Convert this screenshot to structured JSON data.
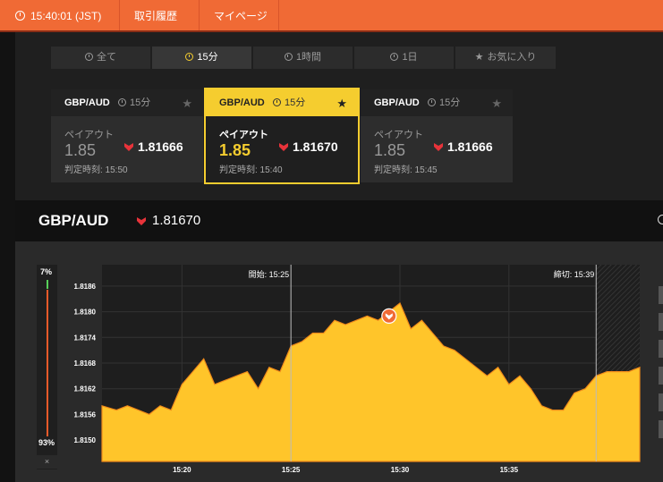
{
  "topbar": {
    "time": "15:40:01 (JST)",
    "history": "取引履歴",
    "mypage": "マイページ"
  },
  "tabs": [
    {
      "label": "全て",
      "icon": "clock-icon",
      "active": false
    },
    {
      "label": "15分",
      "icon": "clock-icon",
      "active": true
    },
    {
      "label": "1時間",
      "icon": "clock-icon",
      "active": false
    },
    {
      "label": "1日",
      "icon": "clock-icon",
      "active": false
    },
    {
      "label": "お気に入り",
      "icon": "star-icon",
      "active": false
    }
  ],
  "cards": [
    {
      "symbol": "GBP/AUD",
      "timeframe": "15分",
      "payout_label": "ペイアウト",
      "payout": "1.85",
      "rate": "1.81666",
      "expiry": "判定時刻: 15:50",
      "selected": false
    },
    {
      "symbol": "GBP/AUD",
      "timeframe": "15分",
      "payout_label": "ペイアウト",
      "payout": "1.85",
      "rate": "1.81670",
      "expiry": "判定時刻: 15:40",
      "selected": true
    },
    {
      "symbol": "GBP/AUD",
      "timeframe": "15分",
      "payout_label": "ペイアウト",
      "payout": "1.85",
      "rate": "1.81666",
      "expiry": "判定時刻: 15:45",
      "selected": false
    }
  ],
  "pair": {
    "symbol": "GBP/AUD",
    "rate": "1.81670"
  },
  "gauge": {
    "top_label": "7%",
    "bottom_label": "93%",
    "close_label": "×",
    "up_fraction": 0.07
  },
  "colors": {
    "accent": "#f06a35",
    "highlight": "#f5cd2f",
    "chart_fill": "#ffc52a",
    "chart_line": "#f08a1a",
    "down": "#e8333a"
  },
  "chart_data": {
    "type": "area",
    "title": "",
    "xlabel": "",
    "ylabel": "",
    "x_ticks": [
      "15:20",
      "15:25",
      "15:30",
      "15:35"
    ],
    "y_ticks": [
      1.815,
      1.8156,
      1.8162,
      1.8168,
      1.8174,
      1.818,
      1.8186
    ],
    "y_tick_labels": [
      "1.8150",
      "1.8156",
      "1.8162",
      "1.8168",
      "1.8174",
      "1.8180",
      "1.8186"
    ],
    "ylim": [
      1.8145,
      1.8191
    ],
    "xlim": [
      "15:16:20",
      "15:41:00"
    ],
    "grid": true,
    "start_label": "開始: 15:25",
    "start_time": "15:25:00",
    "deadline_label": "締切: 15:39",
    "deadline_time": "15:39:00",
    "series": [
      {
        "x": [
          "15:16:20",
          "15:17:00",
          "15:17:30",
          "15:18:00",
          "15:18:30",
          "15:19:00",
          "15:19:30",
          "15:20:00",
          "15:20:30",
          "15:21:00",
          "15:21:30",
          "15:22:00",
          "15:22:30",
          "15:23:00",
          "15:23:30",
          "15:24:00",
          "15:24:30",
          "15:25:00",
          "15:25:30",
          "15:26:00",
          "15:26:30",
          "15:27:00",
          "15:27:30",
          "15:28:00",
          "15:28:30",
          "15:29:00",
          "15:29:30",
          "15:30:00",
          "15:30:30",
          "15:31:00",
          "15:31:30",
          "15:32:00",
          "15:32:30",
          "15:33:00",
          "15:33:30",
          "15:34:00",
          "15:34:30",
          "15:35:00",
          "15:35:30",
          "15:36:00",
          "15:36:30",
          "15:37:00",
          "15:37:30",
          "15:38:00",
          "15:38:30",
          "15:39:00",
          "15:39:30",
          "15:40:00",
          "15:40:30",
          "15:41:00"
        ],
        "values": [
          1.8158,
          1.8157,
          1.8158,
          1.8157,
          1.8156,
          1.8158,
          1.8157,
          1.8163,
          1.8166,
          1.8169,
          1.8163,
          1.8164,
          1.8165,
          1.8166,
          1.8162,
          1.8167,
          1.8166,
          1.8172,
          1.8173,
          1.8175,
          1.8175,
          1.8178,
          1.8177,
          1.8178,
          1.8179,
          1.8178,
          1.818,
          1.8182,
          1.8176,
          1.8178,
          1.8175,
          1.8172,
          1.8171,
          1.8169,
          1.8167,
          1.8165,
          1.8167,
          1.8163,
          1.8165,
          1.8162,
          1.8158,
          1.8157,
          1.8157,
          1.8161,
          1.8162,
          1.8165,
          1.8166,
          1.8166,
          1.8166,
          1.8167
        ]
      }
    ],
    "marker": {
      "x": "15:29:30",
      "y": 1.8179
    }
  }
}
